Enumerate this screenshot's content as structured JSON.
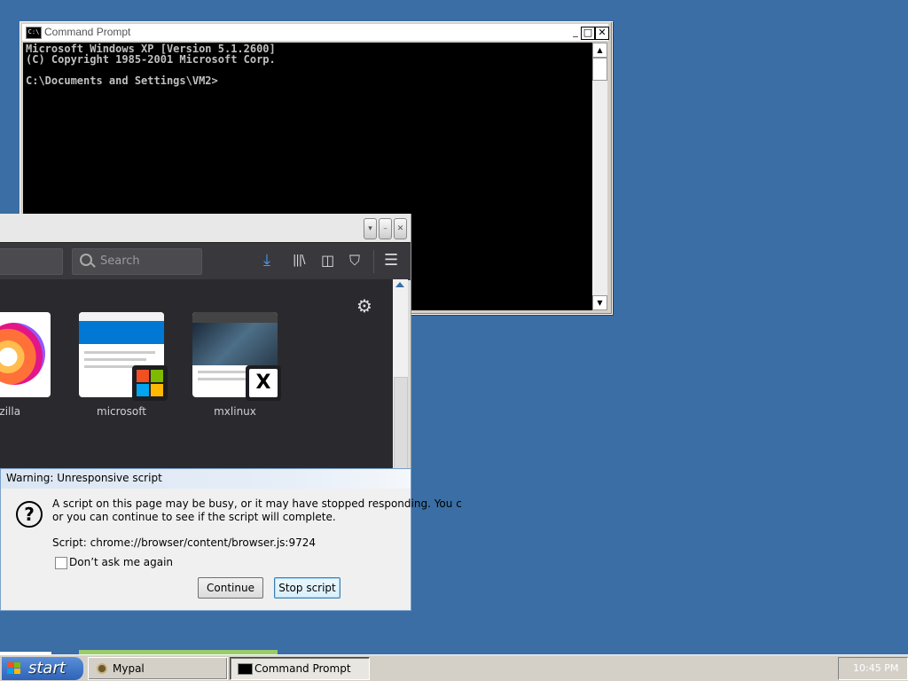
{
  "cmd": {
    "title": "Command Prompt",
    "icon_text": "C:\\",
    "lines": [
      "Microsoft Windows XP [Version 5.1.2600]",
      "(C) Copyright 1985-2001 Microsoft Corp.",
      "",
      "C:\\Documents and Settings\\VM2>"
    ],
    "buttons": {
      "minimize": "_",
      "maximize": "□",
      "close": "✕"
    }
  },
  "firefox": {
    "search_placeholder": "Search",
    "toolbar_icons": [
      "download-icon",
      "library-icon",
      "sidebar-icon",
      "ublock-icon",
      "menu-icon"
    ],
    "tiles": [
      {
        "label": "rt.mozilla"
      },
      {
        "label": "microsoft"
      },
      {
        "label": "mxlinux"
      }
    ],
    "settings_icon": "gear-icon"
  },
  "dialog": {
    "title": "Warning: Unresponsive script",
    "message_line1": "A script on this page may be busy, or it may have stopped responding. You c",
    "message_line2": "or you can continue to see if the script will complete.",
    "script_line": "Script: chrome://browser/content/browser.js:9724",
    "checkbox_label": "Don’t ask me again",
    "continue_label": "Continue",
    "stop_label": "Stop script"
  },
  "taskbar": {
    "start_label": "start",
    "items": [
      {
        "label": "Mypal"
      },
      {
        "label": "Command Prompt"
      }
    ],
    "clock": "10:45 PM"
  }
}
